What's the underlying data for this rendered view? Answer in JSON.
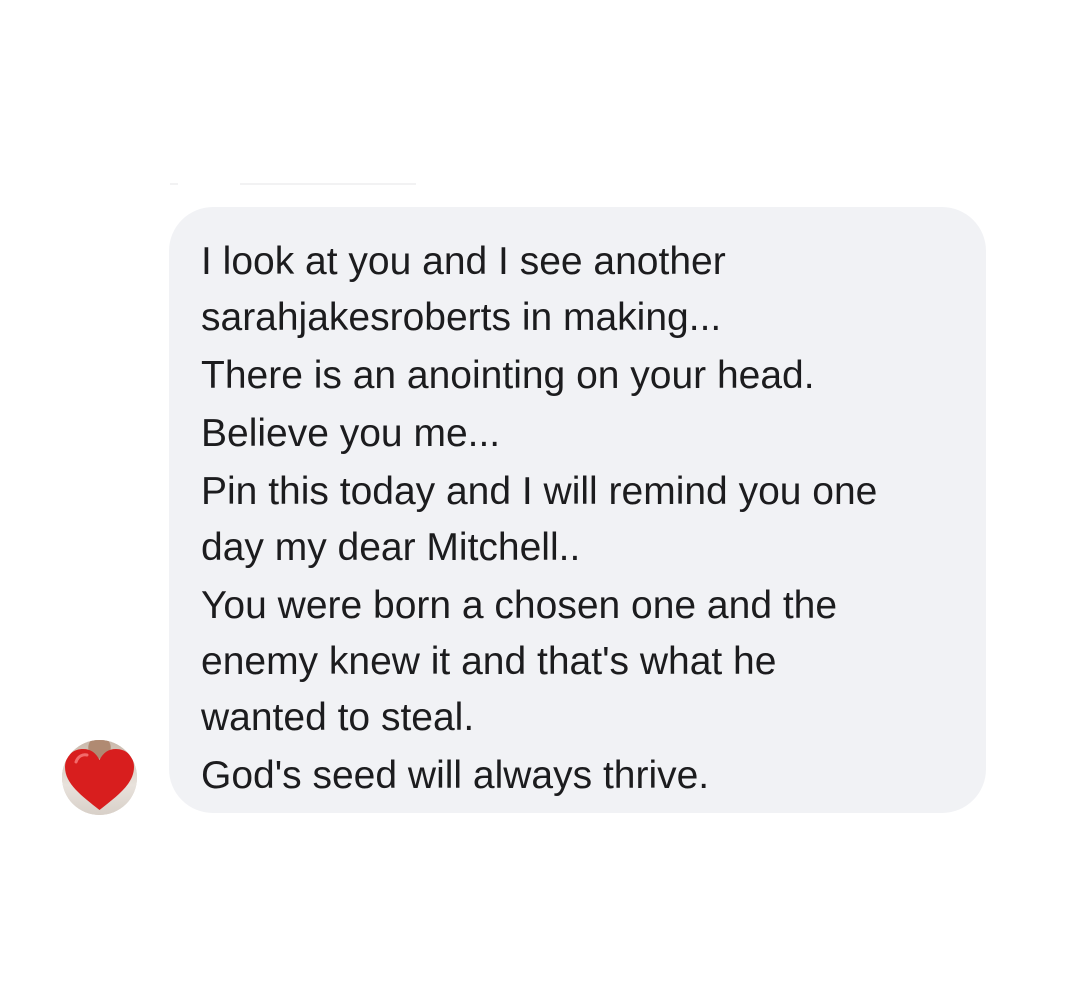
{
  "message": {
    "lines": [
      "I look at you and I see another",
      "sarahjakesroberts in making...",
      "There is an anointing on your head.",
      "Believe you me...",
      "Pin this today and I will remind you one",
      "day my dear Mitchell..",
      "You were born a chosen one and the",
      "enemy knew it and that's what he",
      "wanted to steal.",
      "God's seed will always thrive."
    ]
  },
  "avatar": {
    "icon": "heart-icon",
    "heart_color": "#d81e1e"
  },
  "colors": {
    "bubble_background": "#f1f2f5",
    "text": "#1c1c1e",
    "page_background": "#ffffff"
  }
}
